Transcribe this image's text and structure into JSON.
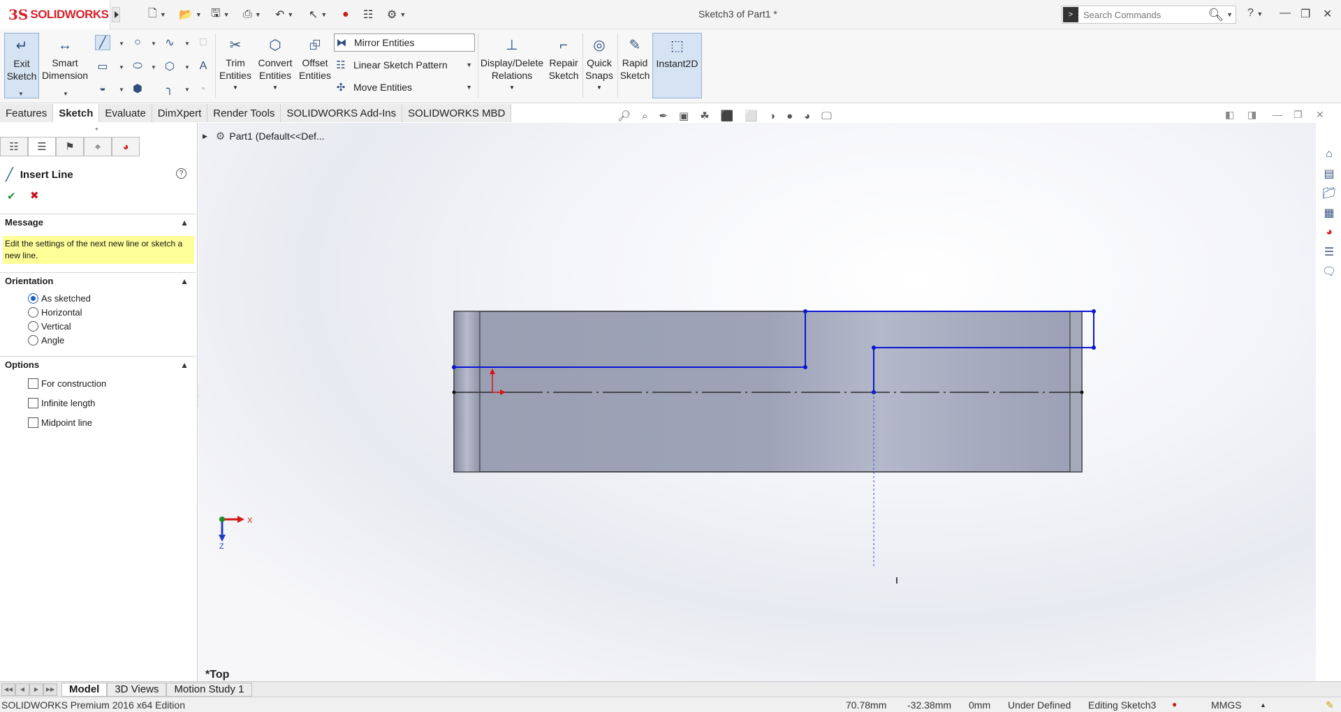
{
  "titlebar": {
    "brand_ds": "3S",
    "brand_name": "SOLIDWORKS",
    "doc_title": "Sketch3 of Part1 *",
    "search_placeholder": "Search Commands",
    "help_label": "?"
  },
  "command_manager": {
    "exit_sketch": "Exit Sketch",
    "smart_dimension": "Smart Dimension",
    "trim_entities": "Trim Entities",
    "convert_entities": "Convert Entities",
    "offset_entities": "Offset Entities",
    "mirror_entities": "Mirror Entities",
    "linear_sketch_pattern": "Linear Sketch Pattern",
    "move_entities": "Move Entities",
    "display_delete_relations": "Display/Delete Relations",
    "repair_sketch": "Repair Sketch",
    "quick_snaps": "Quick Snaps",
    "rapid_sketch": "Rapid Sketch",
    "instant2d": "Instant2D"
  },
  "tabs": [
    "Features",
    "Sketch",
    "Evaluate",
    "DimXpert",
    "Render Tools",
    "SOLIDWORKS Add-Ins",
    "SOLIDWORKS MBD"
  ],
  "active_tab": "Sketch",
  "property_manager": {
    "title": "Insert Line",
    "message_header": "Message",
    "message_text": "Edit the settings of the next new line or sketch a new line.",
    "orientation_header": "Orientation",
    "orientation_options": [
      "As sketched",
      "Horizontal",
      "Vertical",
      "Angle"
    ],
    "orientation_selected": "As sketched",
    "options_header": "Options",
    "option_checkboxes": [
      "For construction",
      "Infinite length",
      "Midpoint line"
    ]
  },
  "feature_tree": {
    "node_label": "Part1  (Default<<Def..."
  },
  "graphics": {
    "view_label": "*Top",
    "triad_x": "X",
    "triad_z": "Z"
  },
  "bottom_tabs": [
    "Model",
    "3D Views",
    "Motion Study 1"
  ],
  "active_bottom_tab": "Model",
  "statusbar": {
    "edition": "SOLIDWORKS Premium 2016 x64 Edition",
    "x_coord": "70.78mm",
    "y_coord": "-32.38mm",
    "z_coord": "0mm",
    "definition": "Under Defined",
    "editing": "Editing Sketch3",
    "units": "MMGS"
  },
  "colors": {
    "brand": "#d6202a",
    "sketch_line": "#0a14d6",
    "part_body": "#9ea3b6",
    "message_bg": "#ffff99"
  }
}
